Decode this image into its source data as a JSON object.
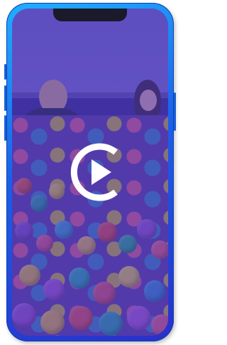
{
  "device": {
    "frame_color": "#1b5fe8",
    "overlay_color": "#4834be"
  },
  "video": {
    "state": "paused",
    "play_icon": "play-icon"
  }
}
